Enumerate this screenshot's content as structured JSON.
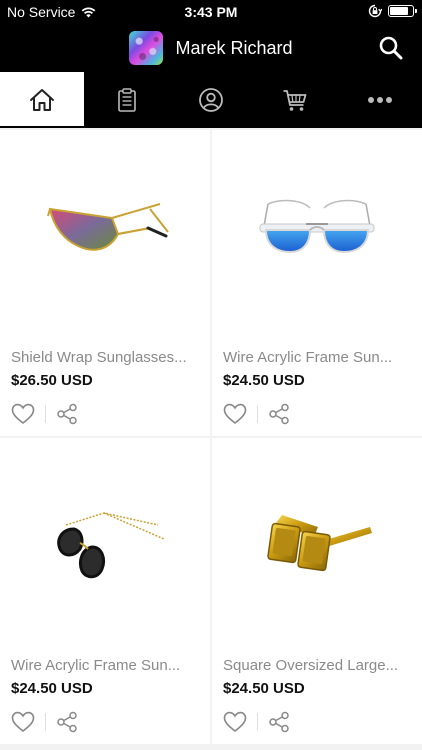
{
  "status_bar": {
    "carrier": "No Service",
    "time": "3:43 PM"
  },
  "header": {
    "title": "Marek Richard"
  },
  "tabs": [
    {
      "icon": "home-icon",
      "active": true
    },
    {
      "icon": "clipboard-icon",
      "active": false
    },
    {
      "icon": "user-icon",
      "active": false
    },
    {
      "icon": "cart-icon",
      "active": false
    },
    {
      "icon": "more-icon",
      "active": false
    }
  ],
  "products": [
    {
      "name": "Shield Wrap Sunglasses...",
      "price": "$26.50 USD",
      "image": "shield-wrap-sunglasses"
    },
    {
      "name": "Wire Acrylic Frame Sun...",
      "price": "$24.50 USD",
      "image": "wire-acrylic-blue-sunglasses"
    },
    {
      "name": "Wire Acrylic Frame Sun...",
      "price": "$24.50 USD",
      "image": "wire-acrylic-black-sunglasses"
    },
    {
      "name": "Square Oversized Large...",
      "price": "$24.50 USD",
      "image": "square-gold-sunglasses"
    }
  ],
  "colors": {
    "bar_background": "#000000",
    "page_background": "#f2f2f2",
    "name_text": "#8a8a8a",
    "price_text": "#111111"
  }
}
